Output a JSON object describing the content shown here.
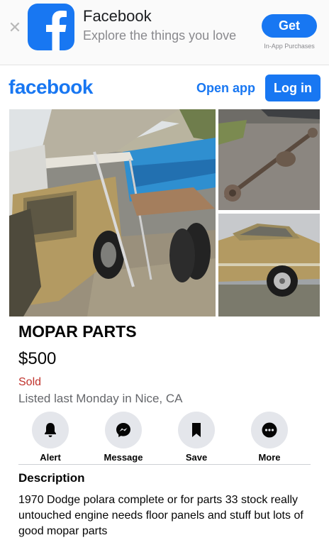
{
  "banner": {
    "close_glyph": "✕",
    "app_name": "Facebook",
    "tagline": "Explore the things you love",
    "get_label": "Get",
    "in_app_note": "In-App Purchases",
    "icon": "facebook-app-icon"
  },
  "header": {
    "logo_text": "facebook",
    "open_app_label": "Open app",
    "login_label": "Log in"
  },
  "listing": {
    "title": "MOPAR PARTS",
    "price": "$500",
    "status": "Sold",
    "meta": "Listed last Monday in Nice, CA"
  },
  "actions": [
    {
      "label": "Alert",
      "icon": "bell-icon"
    },
    {
      "label": "Message",
      "icon": "messenger-icon"
    },
    {
      "label": "Save",
      "icon": "bookmark-icon"
    },
    {
      "label": "More",
      "icon": "more-icon"
    }
  ],
  "description": {
    "heading": "Description",
    "body": "1970 Dodge polara complete or for parts 33 stock really untouched engine needs floor panels and stuff but lots of good mopar parts"
  },
  "colors": {
    "brand": "#1877f2",
    "sold": "#c0332c",
    "action_circle": "#e4e6eb",
    "car_paint": "#b39a62"
  }
}
